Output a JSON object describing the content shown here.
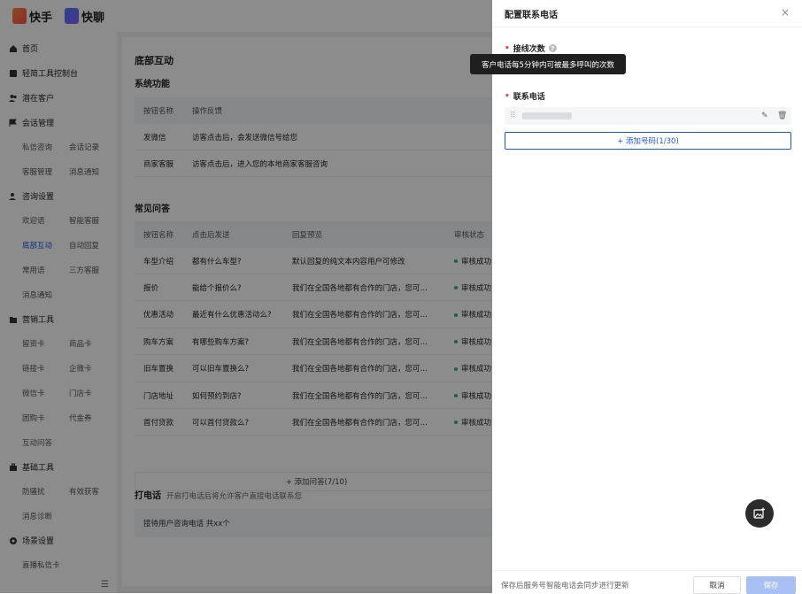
{
  "topbar": {
    "brand1": "快手",
    "brand2": "快聊"
  },
  "sidebar": {
    "groups": [
      {
        "label": "首页",
        "icon": "home-icon"
      },
      {
        "label": "轻简工具控制台",
        "icon": "console-icon"
      },
      {
        "label": "潜在客户",
        "icon": "users-icon"
      },
      {
        "label": "会话管理",
        "icon": "flag-icon"
      },
      {
        "label": "咨询设置",
        "icon": "user-gear-icon"
      },
      {
        "label": "营销工具",
        "icon": "folder-icon"
      },
      {
        "label": "基础工具",
        "icon": "briefcase-icon"
      },
      {
        "label": "场景设置",
        "icon": "settings-icon"
      }
    ],
    "subs": {
      "session": [
        "私信咨询",
        "会话记录",
        "客服管理",
        "消息通知"
      ],
      "consult": [
        "欢迎语",
        "智能客服",
        "底部互动",
        "自动回复",
        "常用语",
        "三方客服",
        "消息通知"
      ],
      "marketing": [
        "留资卡",
        "商品卡",
        "链接卡",
        "企微卡",
        "微信卡",
        "门店卡",
        "团购卡",
        "代金券",
        "互动问答"
      ],
      "basic": [
        "防骚扰",
        "有效获客",
        "消息诊断"
      ],
      "scene": [
        "直播私信卡"
      ]
    }
  },
  "main": {
    "title": "底部互动",
    "system": {
      "title": "系统功能",
      "headers": [
        "按钮名称",
        "操作反馈"
      ],
      "rows": [
        [
          "发微信",
          "访客点击后，会发送微信号给您"
        ],
        [
          "商家客服",
          "访客点击后，进入您的本地商家客服咨询"
        ]
      ]
    },
    "faq": {
      "title": "常见问答",
      "headers": [
        "按钮名称",
        "点击后发送",
        "回复预览",
        "审核状态"
      ],
      "rows": [
        [
          "车型介绍",
          "都有什么车型?",
          "默认回复的纯文本内容用户可修改",
          "审核成功"
        ],
        [
          "报价",
          "能给个报价么?",
          "我们在全国各地都有合作的门店，您可…",
          "审核成功"
        ],
        [
          "优惠活动",
          "最近有什么优惠活动么?",
          "我们在全国各地都有合作的门店，您可…",
          "审核成功"
        ],
        [
          "购车方案",
          "有哪些购车方案?",
          "我们在全国各地都有合作的门店，您可…",
          "审核成功"
        ],
        [
          "旧车置换",
          "可以旧车置换么?",
          "我们在全国各地都有合作的门店，您可…",
          "审核成功"
        ],
        [
          "门店地址",
          "如何预约到店?",
          "我们在全国各地都有合作的门店，您可…",
          "审核成功"
        ],
        [
          "首付贷款",
          "可以首付贷款么?",
          "我们在全国各地都有合作的门店，您可…",
          "审核成功"
        ]
      ],
      "add_label": "+ 添加问答(7/10)"
    },
    "call": {
      "title": "打电话",
      "desc": "开启打电话后将允许客户直接电话联系您",
      "box": "接待用户咨询电话 共xx个"
    }
  },
  "drawer": {
    "title": "配置联系电话",
    "close_glyph": "×",
    "field1_label": "接线次数",
    "tooltip": "客户电话每5分钟内可被最多呼叫的次数",
    "field2_label": "联系电话",
    "add_phone_label": "+ 添加号码(1/30)",
    "footer_note": "保存后服务号智能电话会同步进行更新",
    "cancel_label": "取消",
    "save_label": "保存"
  },
  "colors": {
    "accent": "#1a55e8",
    "success": "#2bb873",
    "overlay": "rgba(0,0,0,0.45)"
  }
}
